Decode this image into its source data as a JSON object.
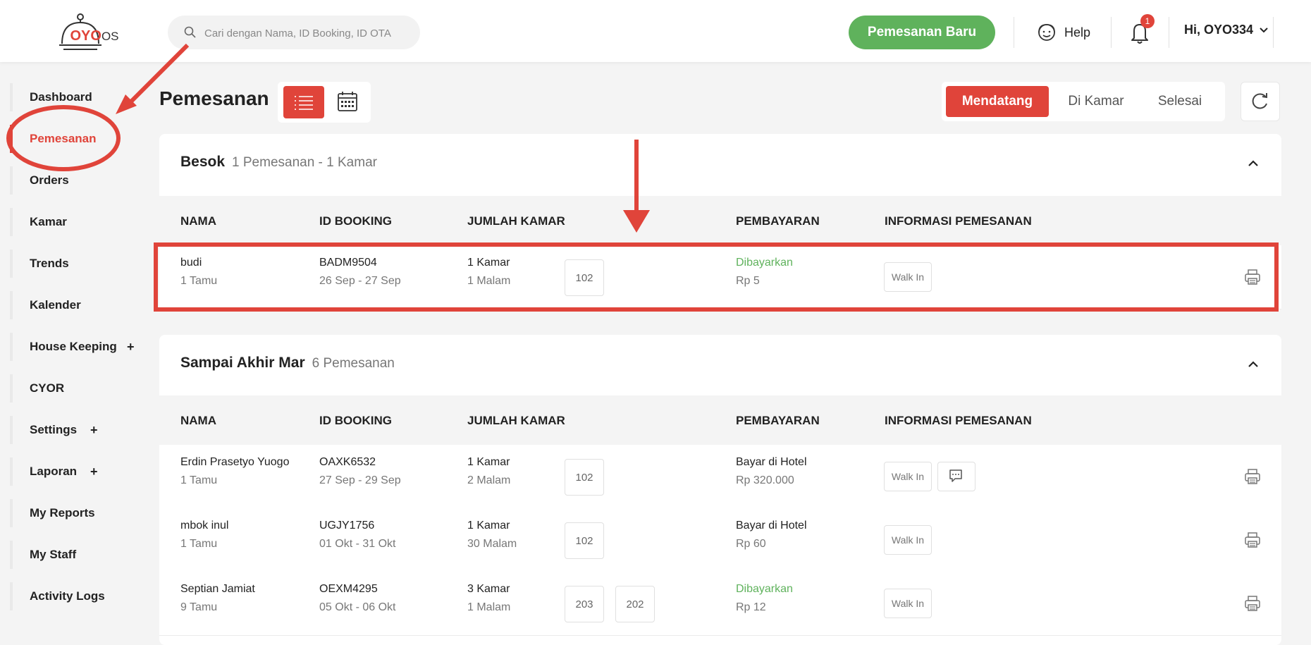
{
  "header": {
    "logo": {
      "brand": "OYO",
      "suffix": "OS"
    },
    "search": {
      "placeholder": "Cari dengan Nama, ID Booking, ID OTA"
    },
    "new_booking_label": "Pemesanan Baru",
    "help_label": "Help",
    "notification_count": "1",
    "user_label": "Hi, OYO334"
  },
  "sidebar": {
    "items": [
      {
        "label": "Dashboard"
      },
      {
        "label": "Pemesanan",
        "active": true
      },
      {
        "label": "Orders"
      },
      {
        "label": "Kamar"
      },
      {
        "label": "Trends"
      },
      {
        "label": "Kalender"
      },
      {
        "label": "House Keeping",
        "expand": "+"
      },
      {
        "label": "CYOR"
      },
      {
        "label": "Settings",
        "expand": "+"
      },
      {
        "label": "Laporan",
        "expand": "+"
      },
      {
        "label": "My Reports"
      },
      {
        "label": "My Staff"
      },
      {
        "label": "Activity Logs"
      }
    ]
  },
  "main": {
    "title": "Pemesanan",
    "status_tabs": [
      "Mendatang",
      "Di Kamar",
      "Selesai"
    ],
    "columns": [
      "NAMA",
      "ID BOOKING",
      "JUMLAH KAMAR",
      "PEMBAYARAN",
      "INFORMASI PEMESANAN"
    ],
    "groups": [
      {
        "title": "Besok",
        "subtitle": "1 Pemesanan - 1 Kamar",
        "rows": [
          {
            "name": "budi",
            "guests": "1 Tamu",
            "booking_id": "BADM9504",
            "dates": "26 Sep - 27 Sep",
            "rooms": "1 Kamar",
            "nights": "1 Malam",
            "room_numbers": [
              "102"
            ],
            "payment_status": "Dibayarkan",
            "amount": "Rp 5",
            "source": "Walk In"
          }
        ]
      },
      {
        "title": "Sampai Akhir Mar",
        "subtitle": "6 Pemesanan",
        "rows": [
          {
            "name": "Erdin Prasetyo Yuogo",
            "guests": "1 Tamu",
            "booking_id": "OAXK6532",
            "dates": "27 Sep - 29 Sep",
            "rooms": "1 Kamar",
            "nights": "2 Malam",
            "room_numbers": [
              "102"
            ],
            "payment_status": "Bayar di Hotel",
            "amount": "Rp 320.000",
            "source": "Walk In"
          },
          {
            "name": "mbok inul",
            "guests": "1 Tamu",
            "booking_id": "UGJY1756",
            "dates": "01 Okt - 31 Okt",
            "rooms": "1 Kamar",
            "nights": "30 Malam",
            "room_numbers": [
              "102"
            ],
            "payment_status": "Bayar di Hotel",
            "amount": "Rp 60",
            "source": "Walk In"
          },
          {
            "name": "Septian Jamiat",
            "guests": "9 Tamu",
            "booking_id": "OEXM4295",
            "dates": "05 Okt - 06 Okt",
            "rooms": "3 Kamar",
            "nights": "1 Malam",
            "room_numbers": [
              "203",
              "202"
            ],
            "payment_status": "Dibayarkan",
            "amount": "Rp 12",
            "source": "Walk In"
          }
        ]
      }
    ]
  },
  "colors": {
    "accent": "#e0443a",
    "success": "#5fb25c"
  }
}
